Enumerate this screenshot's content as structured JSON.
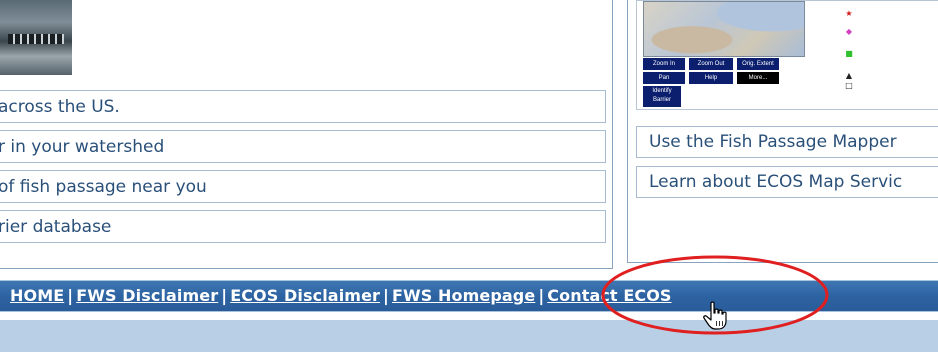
{
  "left": {
    "links": [
      "across the US.",
      "r in your watershed",
      "of fish passage near you",
      "rier database"
    ]
  },
  "right": {
    "map": {
      "buttons": [
        "Zoom In",
        "Zoom Out",
        "Orig. Extent",
        "Pan",
        "Help",
        "More...",
        "Identify Barrier"
      ]
    },
    "links": [
      "Use the Fish Passage Mapper",
      "Learn about ECOS Map Servic"
    ]
  },
  "footer": {
    "links": [
      "HOME",
      "FWS Disclaimer",
      "ECOS Disclaimer",
      "FWS Homepage",
      "Contact ECOS"
    ],
    "separator": "|"
  },
  "colors": {
    "footer_bar": "#2d63a2",
    "link_text": "#2a5079",
    "annotation": "#e02020",
    "bottom_strip": "#b9cfe6"
  },
  "icons": [
    "hand-pointer-icon"
  ]
}
